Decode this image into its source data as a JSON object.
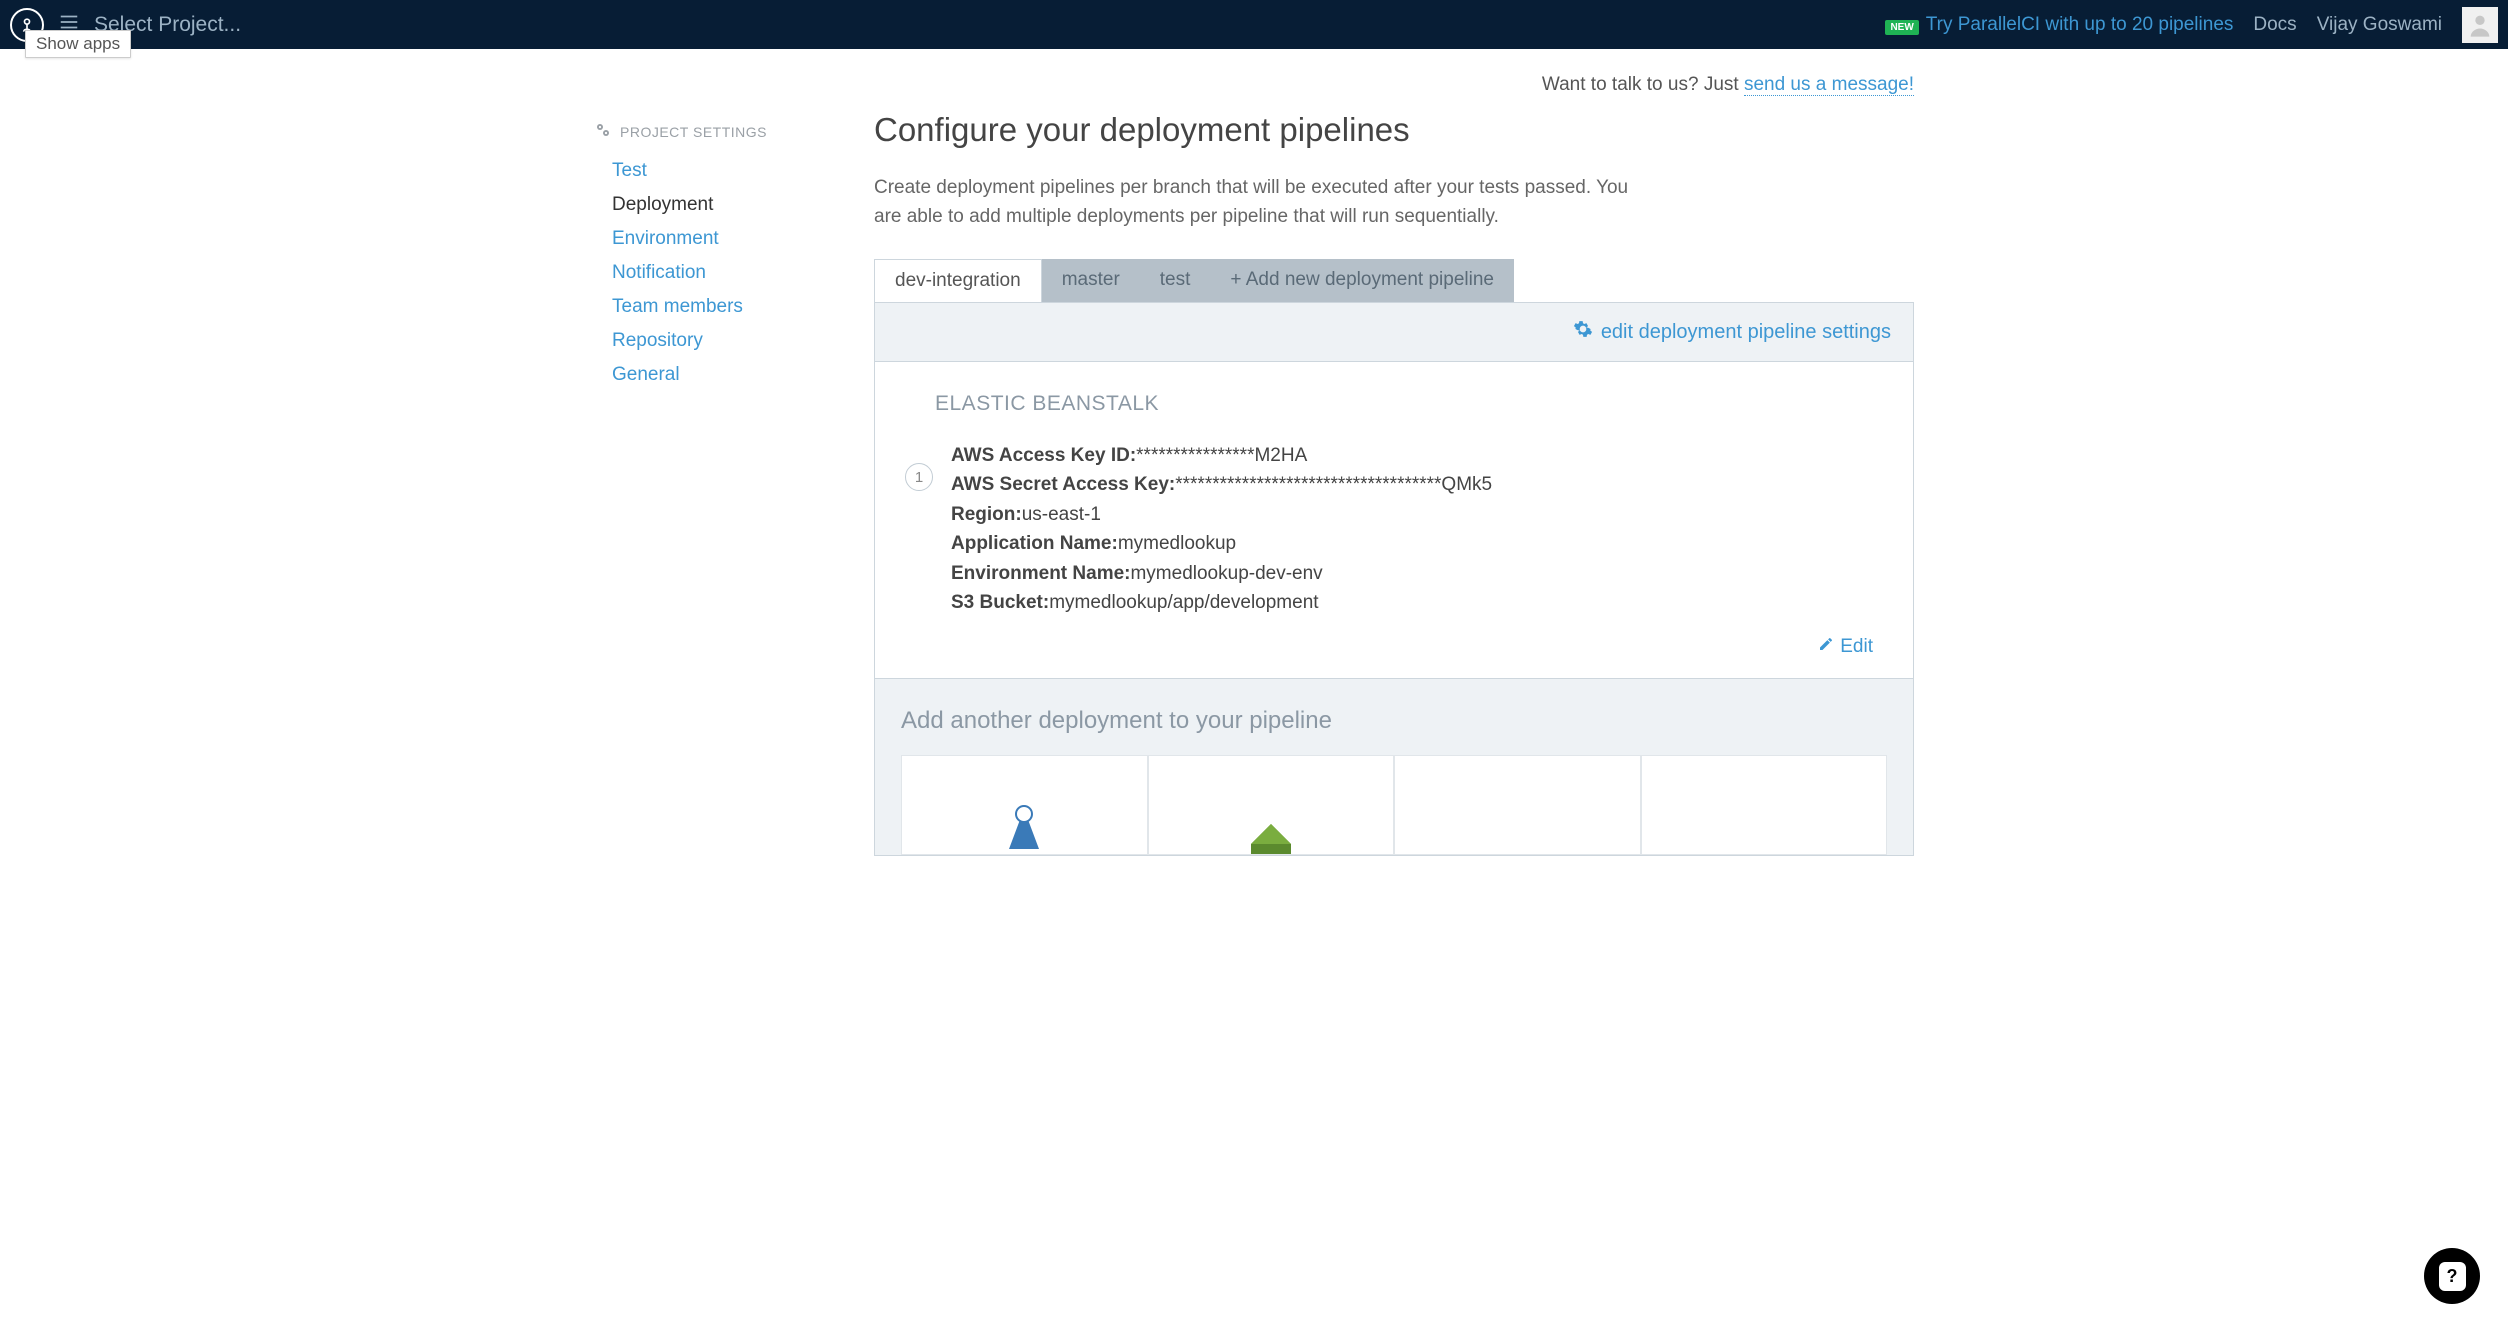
{
  "topbar": {
    "project_label": "Select Project...",
    "new_badge": "NEW",
    "promo_link": "Try ParallelCI with up to 20 pipelines",
    "docs": "Docs",
    "username": "Vijay Goswami",
    "tooltip": "Show apps"
  },
  "message_bar": {
    "prefix": "Want to talk to us? Just ",
    "link": "send us a message!"
  },
  "sidebar": {
    "heading": "PROJECT SETTINGS",
    "items": [
      {
        "label": "Test",
        "active": false
      },
      {
        "label": "Deployment",
        "active": true
      },
      {
        "label": "Environment",
        "active": false
      },
      {
        "label": "Notification",
        "active": false
      },
      {
        "label": "Team members",
        "active": false
      },
      {
        "label": "Repository",
        "active": false
      },
      {
        "label": "General",
        "active": false
      }
    ]
  },
  "page": {
    "title": "Configure your deployment pipelines",
    "description": "Create deployment pipelines per branch that will be executed after your tests passed. You are able to add multiple deployments per pipeline that will run sequentially."
  },
  "tabs": [
    {
      "label": "dev-integration",
      "active": true
    },
    {
      "label": "master",
      "active": false
    },
    {
      "label": "test",
      "active": false
    },
    {
      "label": "+ Add new deployment pipeline",
      "active": false
    }
  ],
  "panel": {
    "edit_settings": "edit deployment pipeline settings",
    "deploy_title": "ELASTIC BEANSTALK",
    "step": "1",
    "fields": [
      {
        "k": "AWS Access Key ID:",
        "v": "****************M2HA"
      },
      {
        "k": "AWS Secret Access Key:",
        "v": "************************************QMk5"
      },
      {
        "k": "Region:",
        "v": "us-east-1"
      },
      {
        "k": "Application Name:",
        "v": "mymedlookup"
      },
      {
        "k": "Environment Name:",
        "v": "mymedlookup-dev-env"
      },
      {
        "k": "S3 Bucket:",
        "v": "mymedlookup/app/development"
      }
    ],
    "edit_link": "Edit",
    "add_another": "Add another deployment to your pipeline"
  },
  "help": "?"
}
